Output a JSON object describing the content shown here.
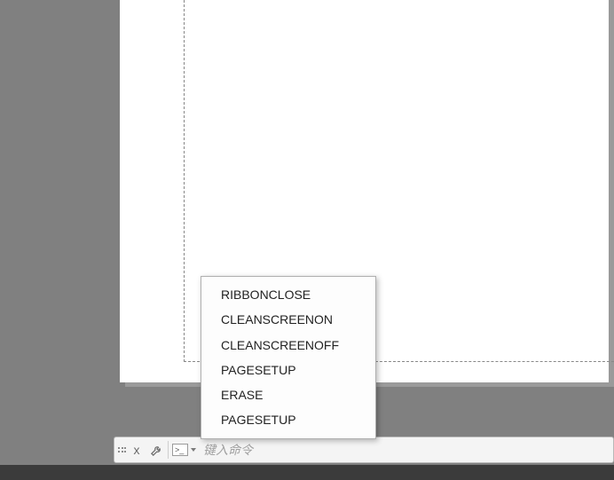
{
  "workspace": {
    "background_color": "#808080",
    "paper_color": "#ffffff"
  },
  "command_bar": {
    "placeholder": "键入命令",
    "value": "",
    "icons": {
      "close": "x",
      "wrench": "wrench-icon",
      "prompt": ">_"
    }
  },
  "suggestions": {
    "items": [
      "RIBBONCLOSE",
      "CLEANSCREENON",
      "CLEANSCREENOFF",
      "PAGESETUP",
      "ERASE",
      "PAGESETUP"
    ]
  }
}
